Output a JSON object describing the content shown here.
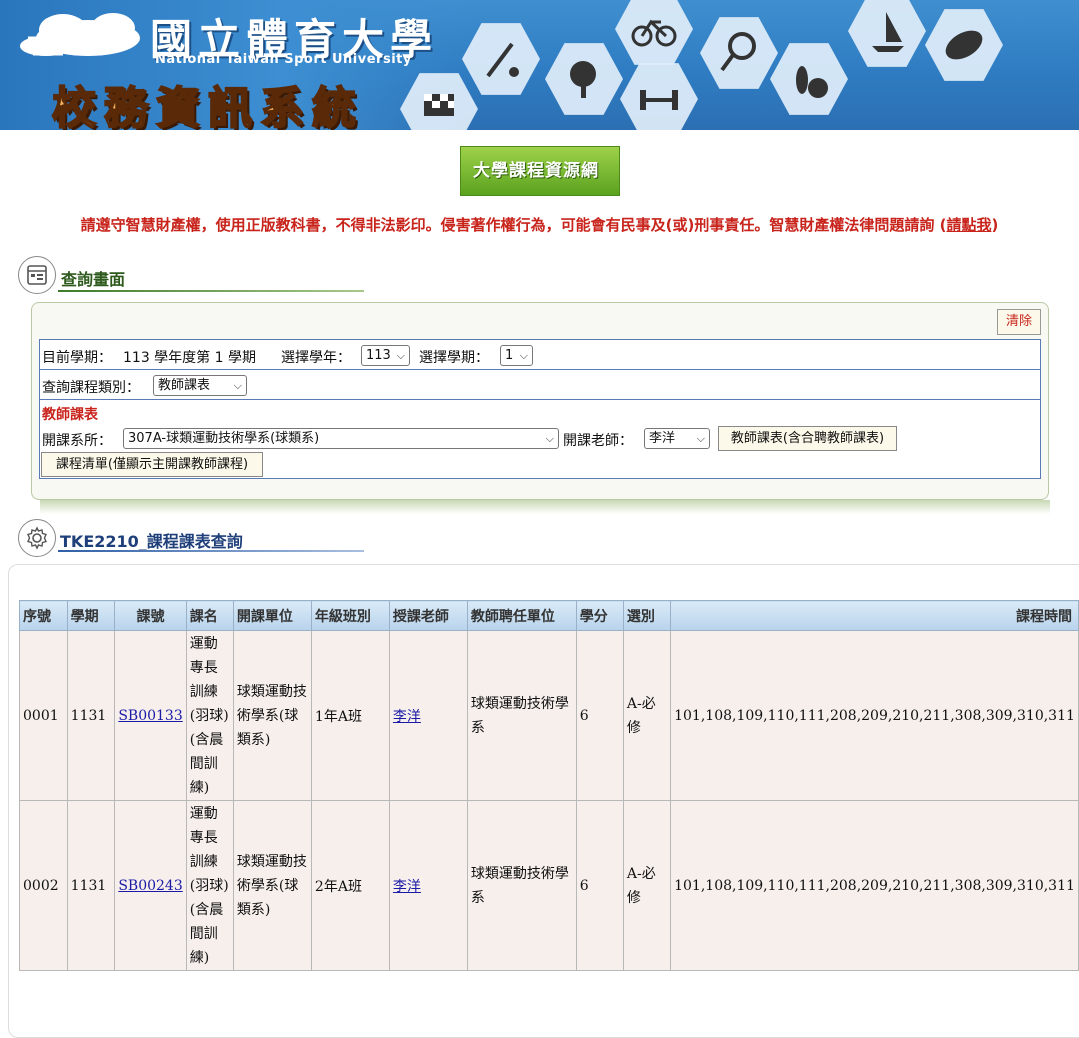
{
  "banner": {
    "title": "國立體育大學",
    "subtitle": "National Taiwan Sport University",
    "system": "校務資訊系統"
  },
  "resource_button": "大學課程資源網",
  "notice": {
    "text": "請遵守智慧財產權，使用正版教科書，不得非法影印。侵害著作權行為，可能會有民事及(或)刑事責任。智慧財產權法律問題請詢 (",
    "link": "請點我",
    "end": ")"
  },
  "query_section": {
    "title": "查詢畫面",
    "clear": "清除",
    "current_term_label": "目前學期：",
    "current_term_value": "113 學年度第 1 學期",
    "year_label": "選擇學年：",
    "year_value": "113",
    "sem_label": "選擇學期：",
    "sem_value": "1",
    "type_label": "查詢課程類別：",
    "type_value": "教師課表",
    "teacher_schedule": "教師課表",
    "dept_label": "開課系所：",
    "dept_value": "307A-球類運動技術學系(球類系)",
    "teacher_label": "開課老師：",
    "teacher_value": "李洋",
    "btn_schedule": "教師課表(含合聘教師課表)",
    "btn_list": "課程清單(僅顯示主開課教師課程)"
  },
  "result_section": {
    "title": "TKE2210_課程課表查詢",
    "headers": [
      "序號",
      "學期",
      "課號",
      "課名",
      "開課單位",
      "年級班別",
      "授課老師",
      "教師聘任單位",
      "學分",
      "選別",
      "課程時間"
    ],
    "rows": [
      {
        "no": "0001",
        "term": "1131",
        "code": "SB00133",
        "name": "運動專長訓練(羽球)(含晨間訓練)",
        "unit": "球類運動技術學系(球類系)",
        "class": "1年A班",
        "teacher": "李洋",
        "teacher_dept": "球類運動技術學系",
        "credit": "6",
        "type": "A-必修",
        "time": "101,108,109,110,111,208,209,210,211,308,309,310,311"
      },
      {
        "no": "0002",
        "term": "1131",
        "code": "SB00243",
        "name": "運動專長訓練(羽球)(含晨間訓練)",
        "unit": "球類運動技術學系(球類系)",
        "class": "2年A班",
        "teacher": "李洋",
        "teacher_dept": "球類運動技術學系",
        "credit": "6",
        "type": "A-必修",
        "time": "101,108,109,110,111,208,209,210,211,308,309,310,311"
      }
    ]
  }
}
